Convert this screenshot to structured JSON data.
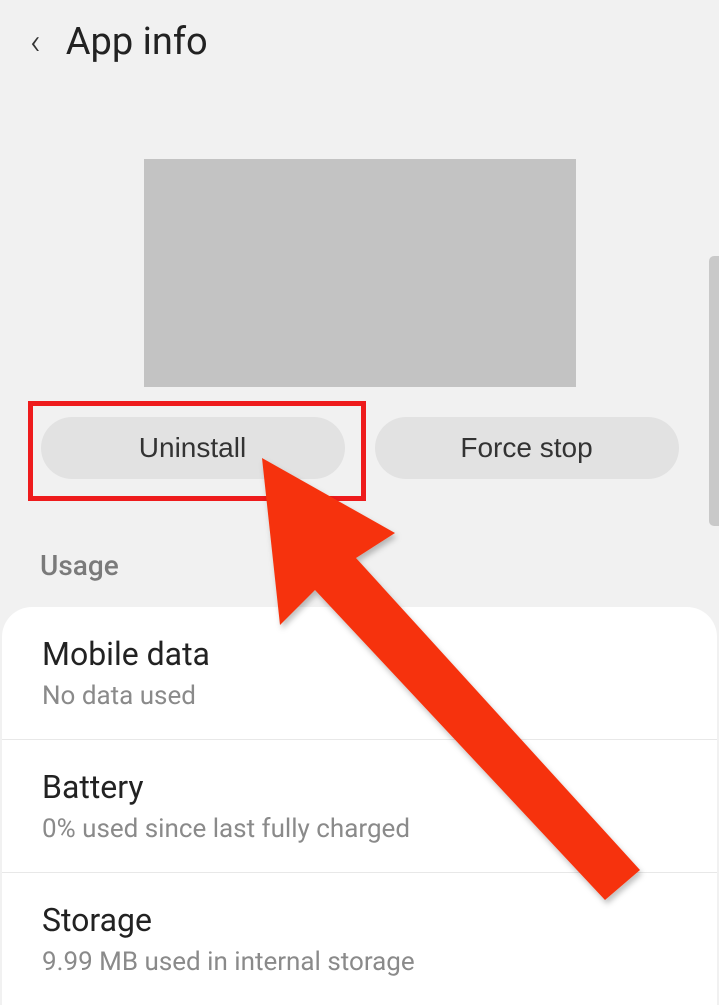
{
  "header": {
    "title": "App info"
  },
  "buttons": {
    "uninstall": "Uninstall",
    "force_stop": "Force stop"
  },
  "section": {
    "usage_label": "Usage"
  },
  "usage": {
    "mobile_data": {
      "title": "Mobile data",
      "subtitle": "No data used"
    },
    "battery": {
      "title": "Battery",
      "subtitle": "0% used since last fully charged"
    },
    "storage": {
      "title": "Storage",
      "subtitle": "9.99 MB used in internal storage"
    }
  },
  "annotation": {
    "highlight_color": "#ee1b1c",
    "arrow_color": "#f6330d"
  }
}
